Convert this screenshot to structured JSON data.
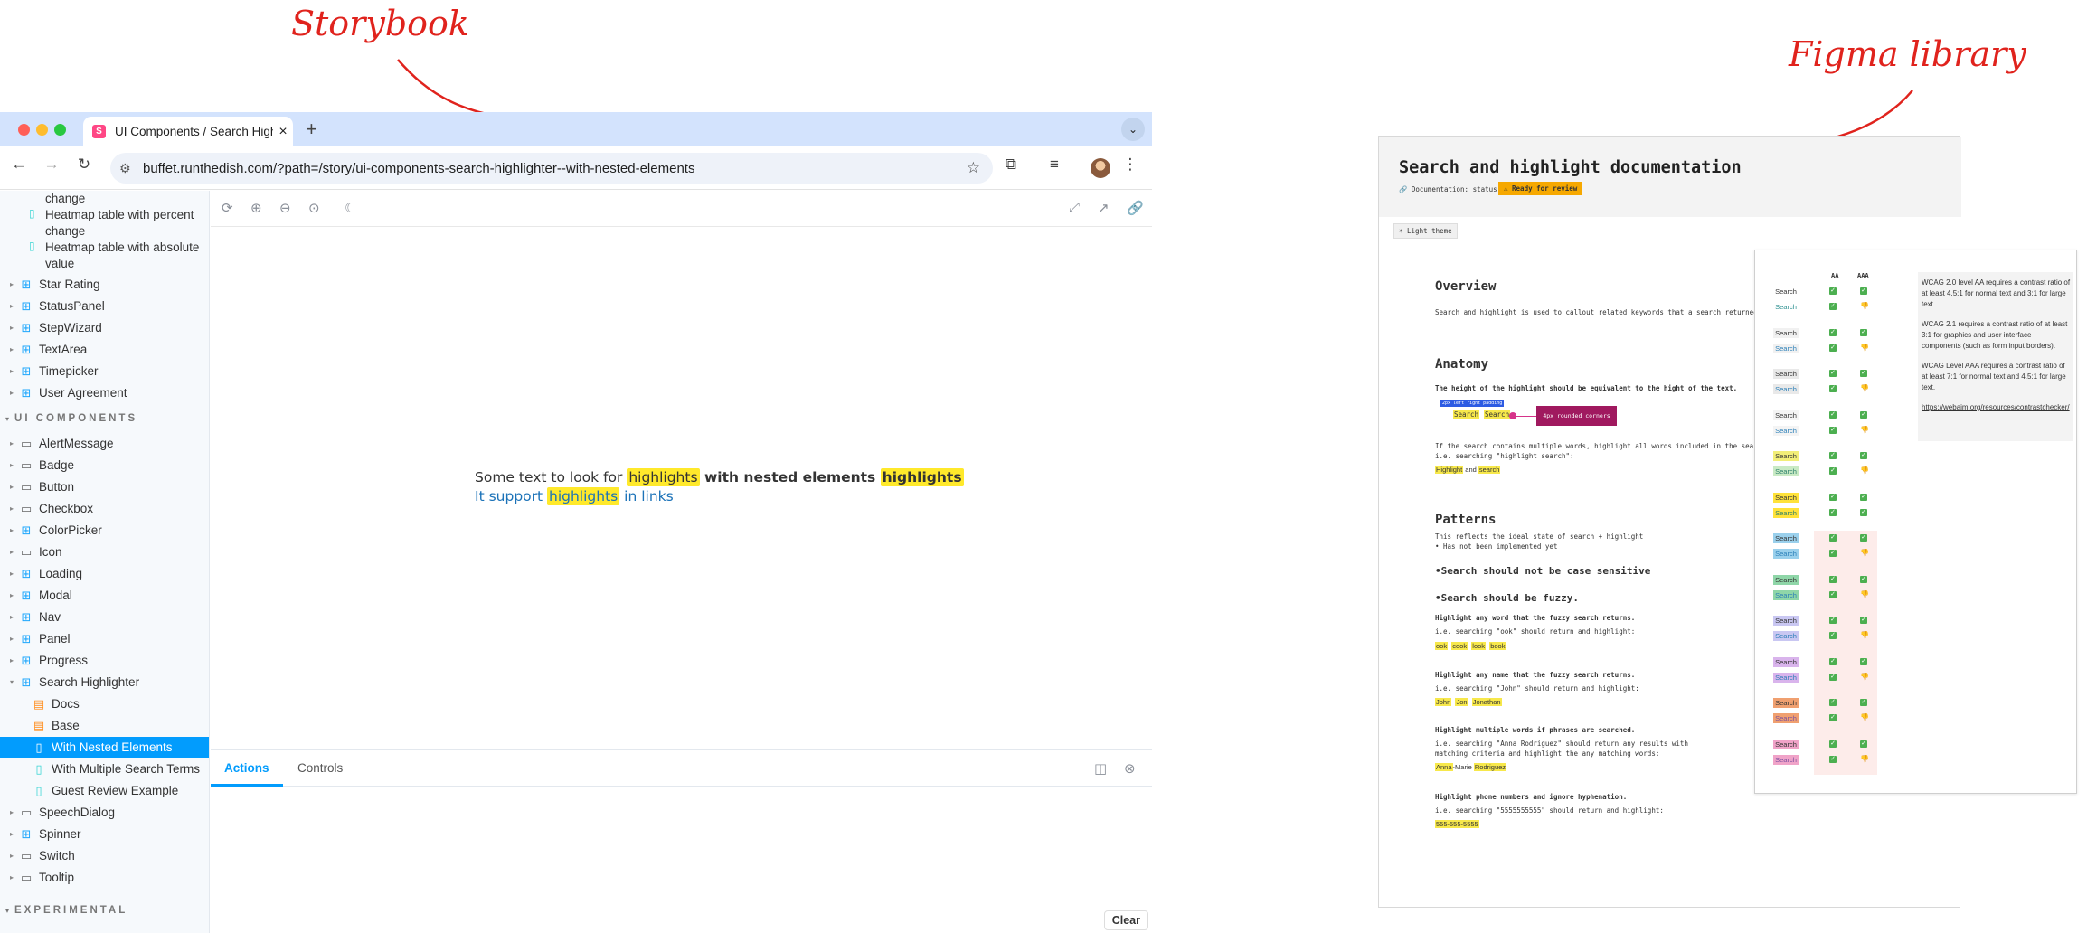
{
  "annotations": {
    "storybook": "Storybook",
    "figma": "Figma library"
  },
  "browser": {
    "tab_title": "UI Components / Search Highl",
    "tab_favicon": "S",
    "url": "buffet.runthedish.com/?path=/story/ui-components-search-highlighter--with-nested-elements"
  },
  "sidebar": {
    "top_items": [
      {
        "label": "change",
        "type": "continued"
      },
      {
        "label": "Heatmap table with percent change",
        "type": "story"
      },
      {
        "label": "Heatmap table with absolute value",
        "type": "story"
      }
    ],
    "components": [
      "Star Rating",
      "StatusPanel",
      "StepWizard",
      "TextArea",
      "Timepicker",
      "User Agreement"
    ],
    "section_ui": "UI COMPONENTS",
    "ui_items": [
      "AlertMessage",
      "Badge",
      "Button",
      "Checkbox",
      "ColorPicker",
      "Icon",
      "Loading",
      "Modal",
      "Nav",
      "Panel",
      "Progress",
      "Search Highlighter"
    ],
    "search_highlighter_children": [
      {
        "label": "Docs",
        "type": "doc"
      },
      {
        "label": "Base",
        "type": "doc"
      },
      {
        "label": "With Nested Elements",
        "type": "story",
        "selected": true
      },
      {
        "label": "With Multiple Search Terms",
        "type": "story"
      },
      {
        "label": "Guest Review Example",
        "type": "story"
      }
    ],
    "after_items": [
      "SpeechDialog",
      "Spinner",
      "Switch",
      "Tooltip"
    ],
    "section_experimental": "EXPERIMENTAL"
  },
  "preview": {
    "line1_a": "Some text to look for ",
    "line1_hl1": "highlights",
    "line1_b": " with nested elements ",
    "line1_hl2": "highlights",
    "line2_a": "It support ",
    "line2_hl": "highlights",
    "line2_b": " in links"
  },
  "addons": {
    "tabs": [
      "Actions",
      "Controls"
    ],
    "clear": "Clear"
  },
  "figma": {
    "title": "Search and highlight documentation",
    "status_label": "🔗 Documentation: status",
    "status_badge": "⚠ Ready for review",
    "theme_chip": "☀ Light theme",
    "overview_h": "Overview",
    "overview_p": "Search and highlight is used to callout related keywords that a search returned.",
    "anatomy_h": "Anatomy",
    "anatomy_p": "The height of the highlight should be equivalent to the hight of the text.",
    "anatomy_tag": "2px left right padding",
    "anatomy_search": "Search",
    "anatomy_corner": "4px rounded corners",
    "anatomy_p2": "If the search contains multiple words, highlight all words included in the search.",
    "anatomy_p3": "i.e. searching \"highlight search\":",
    "anatomy_hl1": "Highlight",
    "anatomy_and": " and ",
    "anatomy_hl2": "search",
    "patterns_h": "Patterns",
    "patterns_p1": "This reflects the ideal state of search + highlight",
    "patterns_p2": "• Has not been implemented yet",
    "rule1": "•Search should not be case sensitive",
    "rule2": "•Search should be fuzzy.",
    "fuzzy_p1": "Highlight any word that the fuzzy search returns.",
    "fuzzy_p2": "i.e. searching \"ook\" should return and highlight:",
    "fuzzy_words": [
      "ook",
      "cook",
      "look",
      "book"
    ],
    "name_p1": "Highlight any name that the fuzzy search returns.",
    "name_p2": "i.e. searching \"John\" should return and highlight:",
    "name_words": [
      "John",
      "Jon",
      "Jonathan"
    ],
    "multi_p1": "Highlight multiple words if phrases are searched.",
    "multi_p2": "i.e. searching \"Anna Rodriguez\" should return any results with",
    "multi_p3": "matching criteria and highlight the any matching words:",
    "multi_hl1": "Anna",
    "multi_mid": "-Marie ",
    "multi_hl2": "Rodriguez",
    "phone_p1": "Highlight phone numbers and ignore hyphenation.",
    "phone_p2": "i.e. searching \"5555555555\" should return and highlight:",
    "phone_hl": "555-555-5555",
    "check_headers": [
      "AA",
      "AAA"
    ],
    "swatch_label": "Search",
    "wcag_1": "WCAG 2.0 level AA requires a contrast ratio of at least 4.5:1 for normal text and 3:1 for large text.",
    "wcag_2": "WCAG 2.1 requires a contrast ratio of at least 3:1 for graphics and user interface components (such as form input borders).",
    "wcag_3": "WCAG Level AAA requires a contrast ratio of at least 7:1 for normal text and 4.5:1 for large text.",
    "wcag_link": "https://webaim.org/resources/contrastchecker/"
  }
}
